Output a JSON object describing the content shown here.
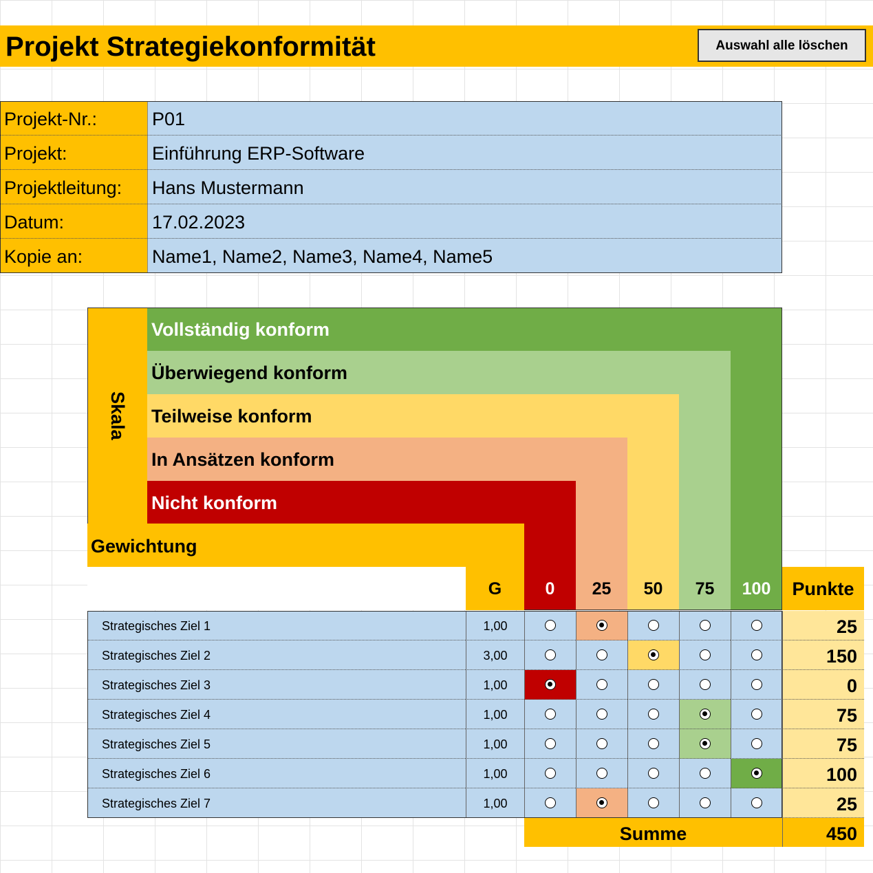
{
  "title": "Projekt Strategiekonformität",
  "clear_button": "Auswahl alle löschen",
  "info": [
    {
      "label": "Projekt-Nr.:",
      "value": "P01"
    },
    {
      "label": "Projekt:",
      "value": "Einführung ERP-Software"
    },
    {
      "label": "Projektleitung:",
      "value": "Hans Mustermann"
    },
    {
      "label": "Datum:",
      "value": "17.02.2023"
    },
    {
      "label": "Kopie an:",
      "value": "Name1, Name2, Name3, Name4, Name5"
    }
  ],
  "skala_label": "Skala",
  "weight_label": "Gewichtung",
  "scale_levels": [
    {
      "label": "Vollständig konform",
      "value": "100",
      "color": "#70ad47",
      "text_color": "#ffffff"
    },
    {
      "label": "Überwiegend konform",
      "value": "75",
      "color": "#a9d08e",
      "text_color": "#000000"
    },
    {
      "label": "Teilweise konform",
      "value": "50",
      "color": "#ffd966",
      "text_color": "#000000"
    },
    {
      "label": "In Ansätzen konform",
      "value": "25",
      "color": "#f4b183",
      "text_color": "#000000"
    },
    {
      "label": "Nicht konform",
      "value": "0",
      "color": "#c00000",
      "text_color": "#ffffff"
    }
  ],
  "columns": {
    "g": "G",
    "points": "Punkte"
  },
  "rows": [
    {
      "label": "Strategisches Ziel 1",
      "g": "1,00",
      "selected": 1,
      "points": "25"
    },
    {
      "label": "Strategisches Ziel 2",
      "g": "3,00",
      "selected": 2,
      "points": "150"
    },
    {
      "label": "Strategisches Ziel 3",
      "g": "1,00",
      "selected": 0,
      "points": "0"
    },
    {
      "label": "Strategisches Ziel 4",
      "g": "1,00",
      "selected": 3,
      "points": "75"
    },
    {
      "label": "Strategisches Ziel 5",
      "g": "1,00",
      "selected": 3,
      "points": "75"
    },
    {
      "label": "Strategisches Ziel 6",
      "g": "1,00",
      "selected": 4,
      "points": "100"
    },
    {
      "label": "Strategisches Ziel 7",
      "g": "1,00",
      "selected": 1,
      "points": "25"
    }
  ],
  "sum_label": "Summe",
  "sum_value": "450",
  "colors": {
    "accent": "#ffc000",
    "info_blue": "#bdd7ee",
    "points_bg": "#ffe699"
  }
}
